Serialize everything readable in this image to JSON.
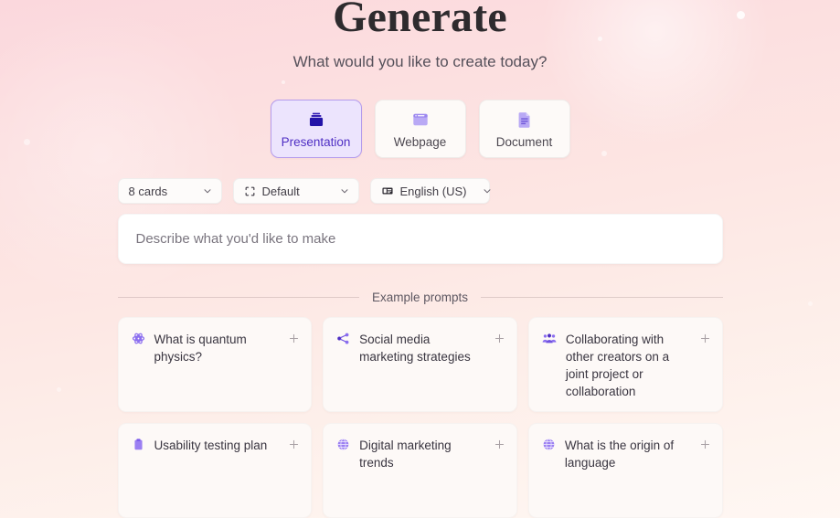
{
  "header": {
    "title": "Generate",
    "subtitle": "What would you like to create today?"
  },
  "colors": {
    "accent_selected_bg": "#ece4fd",
    "accent_selected_border": "#b49bec",
    "accent_text": "#4f2fc4",
    "icon_purple": "#8b6ef0",
    "icon_indigo": "#2b14b0",
    "background_top": "#fbd8dd",
    "background_bottom": "#fff7f3",
    "card_bg": "#fdf9f7",
    "input_bg": "#ffffff"
  },
  "type_selector": {
    "selected": "Presentation",
    "options": [
      {
        "label": "Presentation",
        "icon": "presentation-cards-icon",
        "selected": true
      },
      {
        "label": "Webpage",
        "icon": "browser-window-icon",
        "selected": false
      },
      {
        "label": "Document",
        "icon": "document-file-icon",
        "selected": false
      }
    ]
  },
  "options_row": {
    "cards": {
      "value": "8 cards",
      "icon": "chevron-down-icon"
    },
    "style": {
      "value": "Default",
      "icon": "frame-brackets-icon",
      "caret": "chevron-down-icon"
    },
    "language": {
      "value": "English (US)",
      "icon": "language-card-icon",
      "caret": "chevron-down-icon"
    }
  },
  "prompt": {
    "value": "",
    "placeholder": "Describe what you'd like to make"
  },
  "examples": {
    "divider_label": "Example prompts",
    "add_icon": "plus-icon",
    "cards": [
      {
        "text": "What is quantum physics?",
        "icon": "atom-icon"
      },
      {
        "text": "Social media marketing strategies",
        "icon": "share-icon"
      },
      {
        "text": "Collaborating with other creators on a joint project or collaboration",
        "icon": "people-group-icon"
      },
      {
        "text": "Usability testing plan",
        "icon": "clipboard-icon"
      },
      {
        "text": "Digital marketing trends",
        "icon": "globe-icon"
      },
      {
        "text": "What is the origin of language",
        "icon": "globe-icon"
      }
    ]
  }
}
